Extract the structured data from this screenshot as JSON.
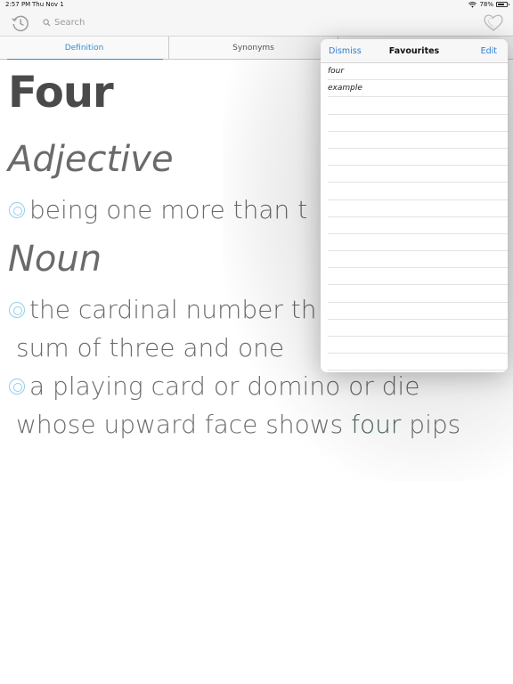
{
  "status_bar": {
    "time": "2:57 PM",
    "date": "Thu Nov 1",
    "battery": "78%"
  },
  "search": {
    "placeholder": "Search"
  },
  "tabs": [
    {
      "label": "Definition",
      "active": true
    },
    {
      "label": "Synonyms",
      "active": false
    }
  ],
  "entry": {
    "word": "Four",
    "sections": [
      {
        "pos": "Adjective",
        "senses": [
          "being one more than t"
        ]
      },
      {
        "pos": "Noun",
        "senses": [
          "the cardinal number th",
          "sum of three and one",
          "a playing card or domino or die",
          "whose upward face shows ",
          "four",
          " pips"
        ]
      }
    ]
  },
  "favourites": {
    "dismiss_label": "Dismiss",
    "title": "Favourites",
    "edit_label": "Edit",
    "items": [
      "four",
      "example"
    ]
  },
  "colors": {
    "accent": "#2b8fd6",
    "bullet": "#8fd0ec",
    "text": "#6a6a6a"
  },
  "icons": {
    "history": "clock-history-icon",
    "search": "magnifier-icon",
    "favourites": "heart-icon",
    "bullet": "concentric-circle-icon"
  }
}
